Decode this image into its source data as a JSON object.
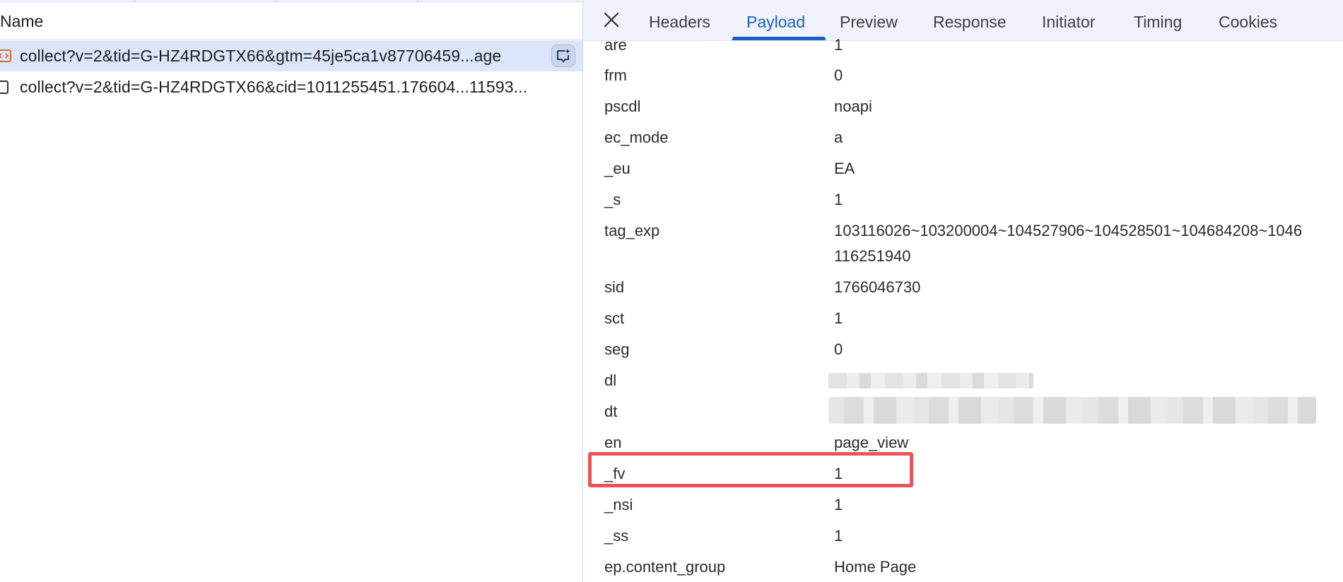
{
  "request_list": {
    "column_header": "Name",
    "requests": [
      {
        "text": "collect?v=2&tid=G-HZ4RDGTX66&gtm=45je5ca1v87706459...age",
        "selected": true
      },
      {
        "text": "collect?v=2&tid=G-HZ4RDGTX66&cid=1011255451.176604...11593...",
        "selected": false
      }
    ]
  },
  "detail_panel": {
    "tabs": [
      "Headers",
      "Payload",
      "Preview",
      "Response",
      "Initiator",
      "Timing",
      "Cookies"
    ],
    "active_tab": "Payload",
    "payload": [
      {
        "key": "are",
        "value": "1"
      },
      {
        "key": "frm",
        "value": "0"
      },
      {
        "key": "pscdl",
        "value": "noapi"
      },
      {
        "key": "ec_mode",
        "value": "a"
      },
      {
        "key": "_eu",
        "value": "EA"
      },
      {
        "key": "_s",
        "value": "1"
      },
      {
        "key": "tag_exp",
        "value": "103116026~103200004~104527906~104528501~104684208~1046",
        "value_line2": "116251940"
      },
      {
        "key": "sid",
        "value": "1766046730"
      },
      {
        "key": "sct",
        "value": "1"
      },
      {
        "key": "seg",
        "value": "0"
      },
      {
        "key": "dl",
        "value": ""
      },
      {
        "key": "dt",
        "value": ""
      },
      {
        "key": "en",
        "value": "page_view"
      },
      {
        "key": "_fv",
        "value": "1"
      },
      {
        "key": "_nsi",
        "value": "1"
      },
      {
        "key": "_ss",
        "value": "1"
      },
      {
        "key": "ep.content_group",
        "value": "Home Page"
      }
    ]
  },
  "colors": {
    "accent": "#1a5fcf",
    "selected_row": "#dbe6fb",
    "highlight_box": "#e8545a"
  }
}
